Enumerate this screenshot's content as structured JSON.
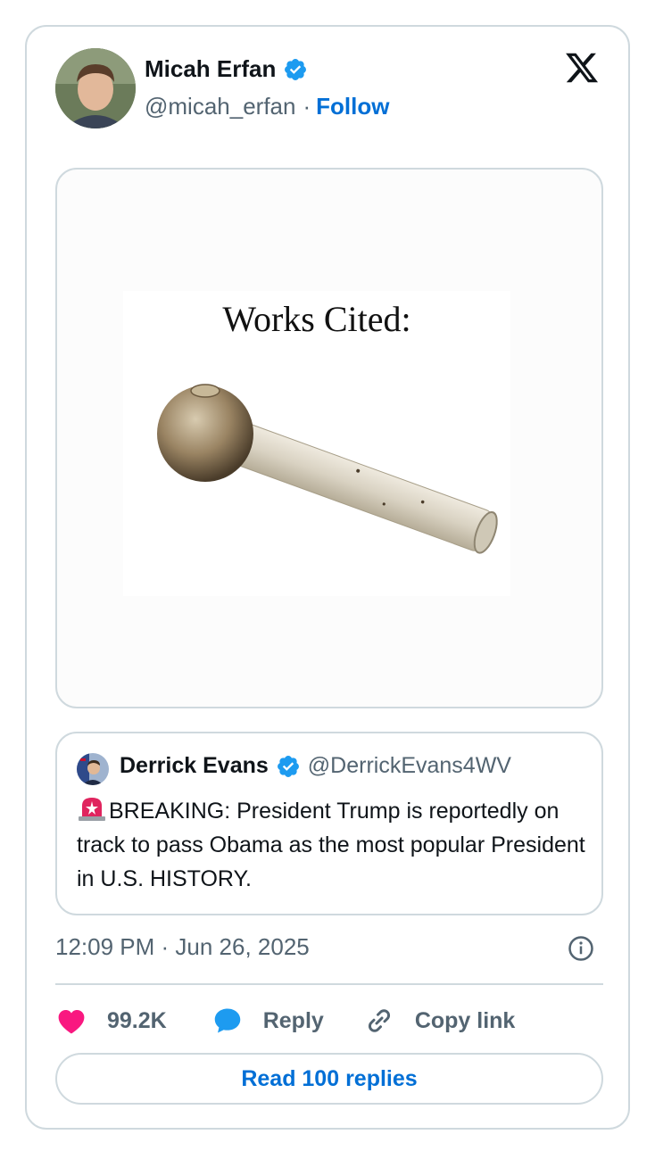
{
  "author": {
    "name": "Micah Erfan",
    "handle": "@micah_erfan",
    "separator": "·",
    "follow_label": "Follow",
    "verified": true
  },
  "brand": {
    "logo_icon": "x-logo-icon"
  },
  "media": {
    "caption_text": "Works Cited:",
    "image_subject": "glass pipe"
  },
  "quoted_tweet": {
    "name": "Derrick Evans",
    "handle": "@DerrickEvans4WV",
    "verified": true,
    "alert_icon": "police-light-emoji",
    "text": "BREAKING: President Trump is reportedly on track to pass Obama as the most popular President in U.S. HISTORY."
  },
  "timestamp": "12:09 PM · Jun 26, 2025",
  "actions": {
    "like_count": "99.2K",
    "reply_label": "Reply",
    "copy_link_label": "Copy link"
  },
  "read_replies_label": "Read 100 replies",
  "colors": {
    "link_blue": "#006fd6",
    "verified_blue": "#1d9bf0",
    "like_pink": "#f91880",
    "border": "#cfd9de",
    "muted_text": "#536471"
  }
}
